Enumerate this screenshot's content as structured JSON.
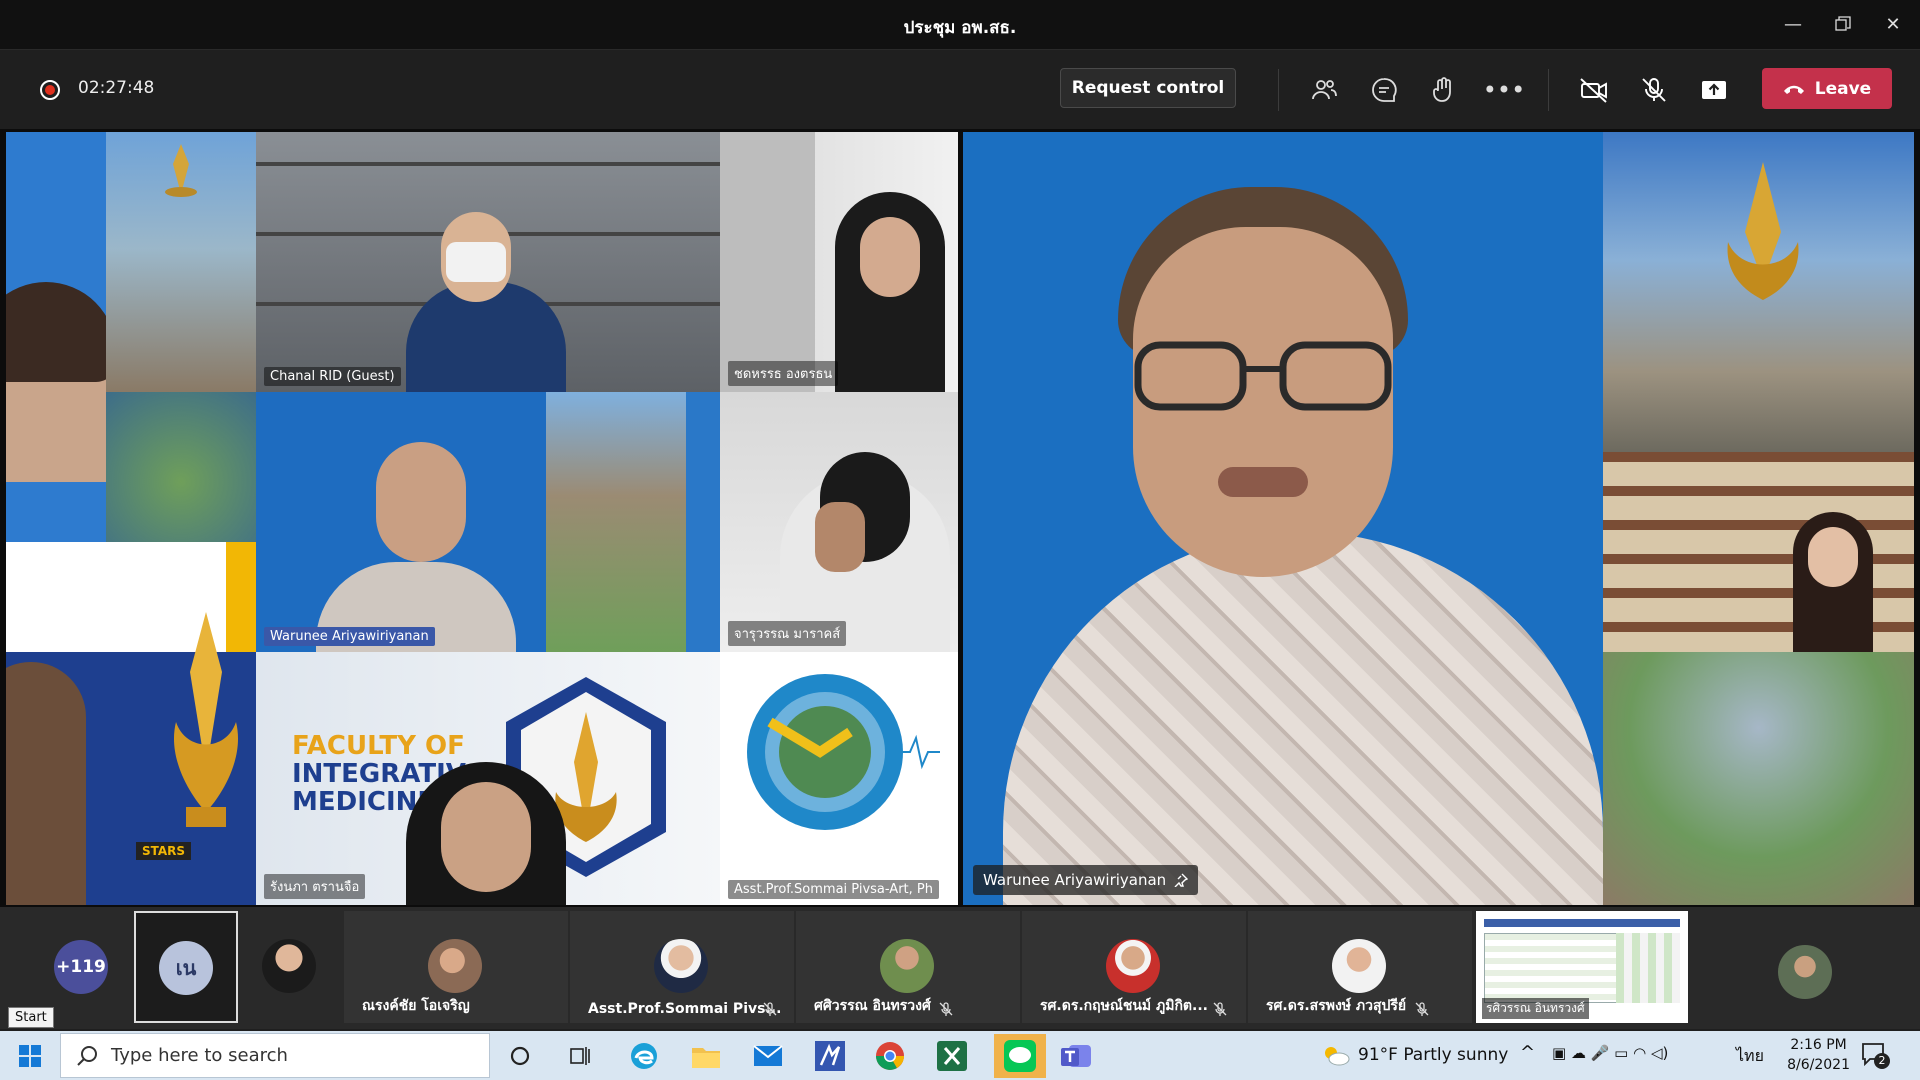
{
  "window": {
    "title": "ประชุม อพ.สธ."
  },
  "toolbar": {
    "timer": "02:27:48",
    "request_control": "Request control",
    "leave": "Leave"
  },
  "gallery": {
    "tiles": [
      {
        "label": "Chanal RID (Guest)"
      },
      {
        "label": "ชดหรรธ องตรธน"
      },
      {
        "label": "Warunee Ariyawiriyanan"
      },
      {
        "label": "จารุวรรณ มาราคส์"
      },
      {
        "label": "รังนภา ตรานจือ"
      },
      {
        "label": "Asst.Prof.Sommai Pivsa-Art, Ph"
      }
    ],
    "poster_text": [
      "FACULTY OF",
      "INTEGRATIV",
      "MEDICINE"
    ],
    "stars_badge": "STARS"
  },
  "spotlight": {
    "name": "Warunee Ariyawiriyanan"
  },
  "strip": {
    "overflow_count": "+119",
    "self_initials": "เน",
    "participants": [
      {
        "name": "ณรงค์ชัย โอเจริญ"
      },
      {
        "name": "Asst.Prof.Sommai Pivs..."
      },
      {
        "name": "ศศิวรรณ อินทรวงศ์"
      },
      {
        "name": "รศ.ดร.กฤษณ์ชนม์ ภูมิกิต..."
      },
      {
        "name": "รศ.ดร.สรพงษ์ ภวสุปรีย์"
      }
    ],
    "shared_caption": "รศิวรรณ อินทรวงศ์"
  },
  "start_tooltip": "Start",
  "taskbar": {
    "search_placeholder": "Type here to search",
    "weather": "91°F  Partly sunny",
    "language": "ไทย",
    "time": "2:16 PM",
    "date": "8/6/2021",
    "notification_count": "2"
  },
  "colors": {
    "leave": "#c4314b",
    "video_bg": "#1b6fc1",
    "record": "#e0301e"
  }
}
